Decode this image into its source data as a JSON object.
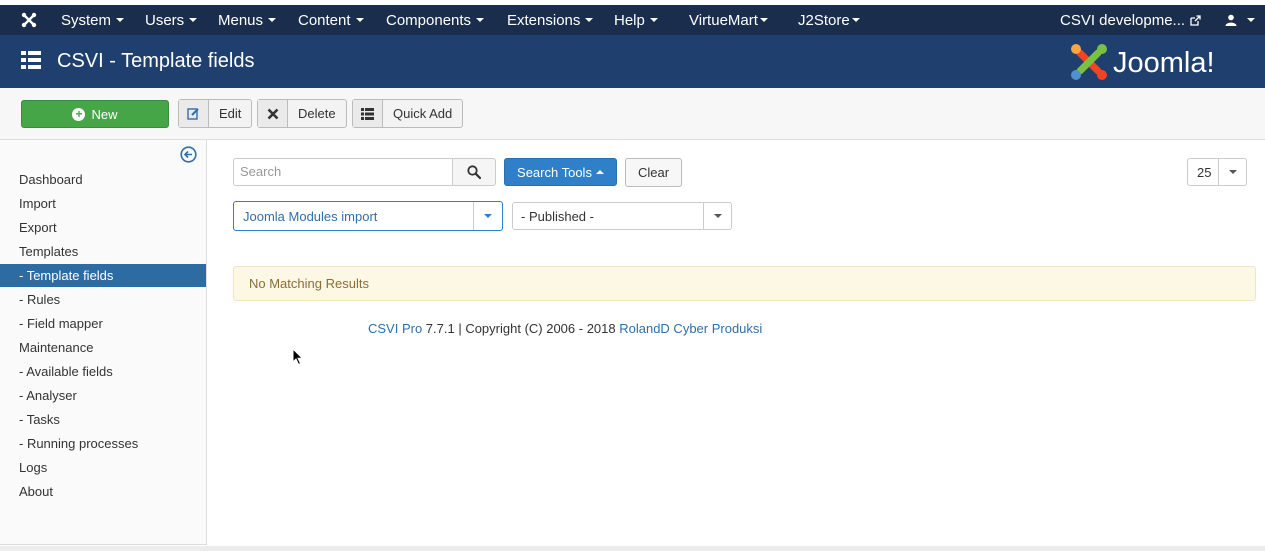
{
  "topbar": {
    "menus": [
      "System",
      "Users",
      "Menus",
      "Content",
      "Components",
      "Extensions",
      "Help",
      "VirtueMart",
      "J2Store"
    ],
    "site_link": "CSVI developme...",
    "icons": {
      "logo": "joomla-logo-icon",
      "external": "external-link-icon",
      "user": "user-icon"
    }
  },
  "header": {
    "title": "CSVI - Template fields",
    "logo_text": "Joomla!",
    "icons": {
      "menu": "list-icon"
    }
  },
  "toolbar": {
    "new_label": "New",
    "edit_label": "Edit",
    "delete_label": "Delete",
    "quick_add_label": "Quick Add"
  },
  "sidebar": {
    "items": [
      {
        "label": "Dashboard",
        "active": false
      },
      {
        "label": "Import",
        "active": false
      },
      {
        "label": "Export",
        "active": false
      },
      {
        "label": "Templates",
        "active": false
      },
      {
        "label": "- Template fields",
        "active": true
      },
      {
        "label": "- Rules",
        "active": false
      },
      {
        "label": "- Field mapper",
        "active": false
      },
      {
        "label": "Maintenance",
        "active": false
      },
      {
        "label": "- Available fields",
        "active": false
      },
      {
        "label": "- Analyser",
        "active": false
      },
      {
        "label": "- Tasks",
        "active": false
      },
      {
        "label": "- Running processes",
        "active": false
      },
      {
        "label": "Logs",
        "active": false
      },
      {
        "label": "About",
        "active": false
      }
    ]
  },
  "filters": {
    "search_placeholder": "Search",
    "search_tools_label": "Search Tools",
    "clear_label": "Clear",
    "limit_value": "25",
    "template_value": "Joomla Modules import",
    "published_value": "- Published -"
  },
  "results": {
    "empty_message": "No Matching Results"
  },
  "footer": {
    "product": "CSVI Pro",
    "copyright": " 7.7.1 | Copyright (C) 2006 - 2018 ",
    "company": "RolandD Cyber Produksi"
  },
  "colors": {
    "topbar": "#1a2d4c",
    "titlebar": "#1f3f6e",
    "new_button": "#46a546",
    "primary": "#2f80c8",
    "sidebar_active": "#2d6ca2"
  }
}
